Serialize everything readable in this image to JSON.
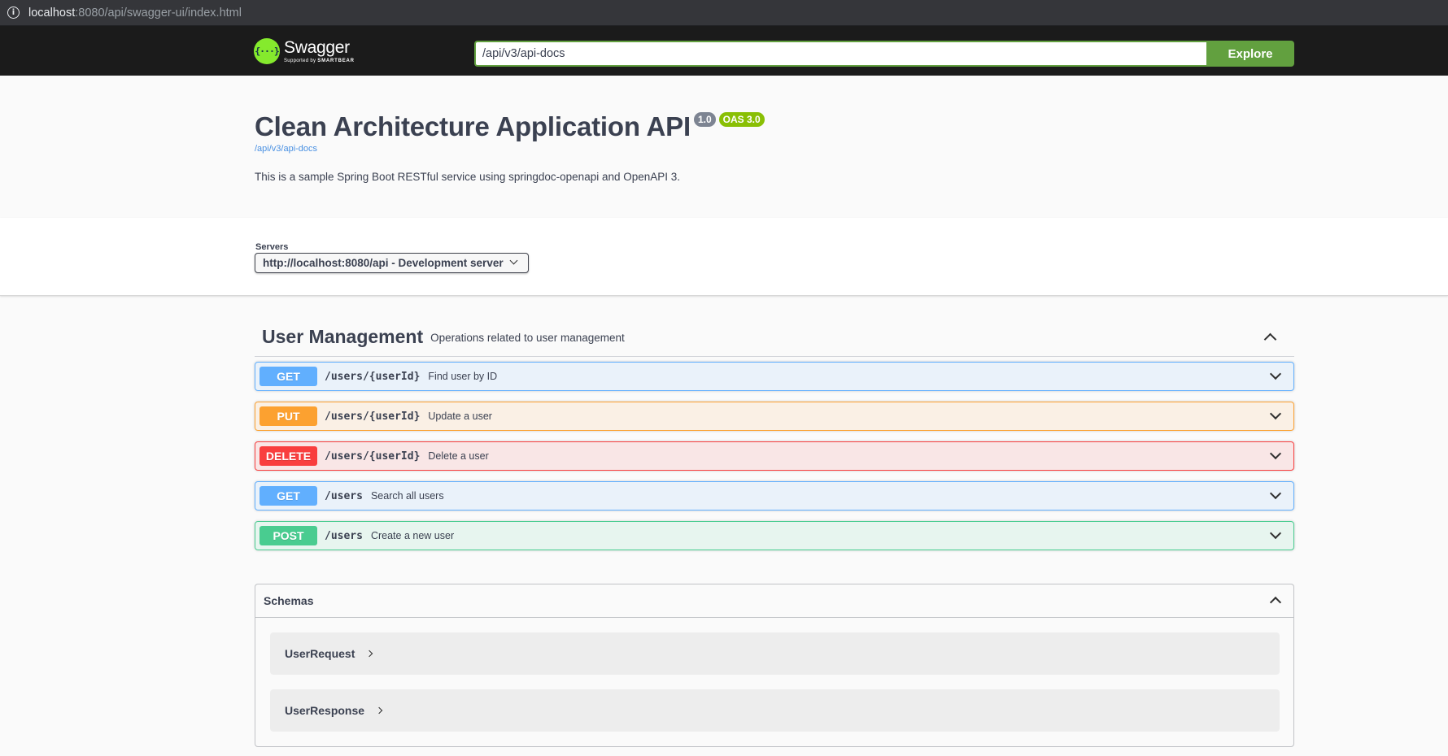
{
  "browser": {
    "url_host": "localhost",
    "url_rest": ":8080/api/swagger-ui/index.html"
  },
  "topbar": {
    "logo_mark": "{···}",
    "logo_name": "Swagger",
    "logo_sub_prefix": "Supported by ",
    "logo_sub_brand": "SMARTBEAR",
    "spec_url": "/api/v3/api-docs",
    "explore_label": "Explore"
  },
  "info": {
    "title": "Clean Architecture Application API",
    "version_badge": "1.0",
    "oas_badge": "OAS 3.0",
    "spec_link": "/api/v3/api-docs",
    "description": "This is a sample Spring Boot RESTful service using springdoc-openapi and OpenAPI 3."
  },
  "servers": {
    "label": "Servers",
    "selected": "http://localhost:8080/api - Development server"
  },
  "tag": {
    "name": "User Management",
    "description": "Operations related to user management"
  },
  "operations": [
    {
      "method": "GET",
      "path": "/users/{userId}",
      "summary": "Find user by ID"
    },
    {
      "method": "PUT",
      "path": "/users/{userId}",
      "summary": "Update a user"
    },
    {
      "method": "DELETE",
      "path": "/users/{userId}",
      "summary": "Delete a user"
    },
    {
      "method": "GET",
      "path": "/users",
      "summary": "Search all users"
    },
    {
      "method": "POST",
      "path": "/users",
      "summary": "Create a new user"
    }
  ],
  "schemas": {
    "title": "Schemas",
    "models": [
      "UserRequest",
      "UserResponse"
    ]
  },
  "colors": {
    "get": "#61affe",
    "put": "#fca130",
    "delete": "#f93e3e",
    "post": "#49cc90",
    "explore": "#62a03f",
    "topbar": "#1b1b1b"
  }
}
